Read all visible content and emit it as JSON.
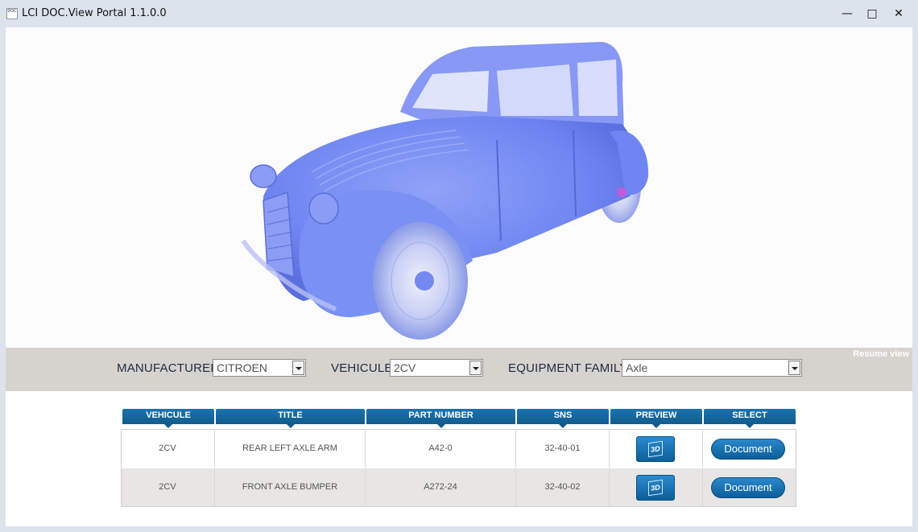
{
  "window": {
    "title": "LCI DOC.View Portal 1.1.0.0",
    "icon_text": "DOC",
    "minimize": "—",
    "maximize": "□",
    "close": "✕"
  },
  "viewer": {
    "model_name": "car-3d-model",
    "model_color": "#6f86f2"
  },
  "filters": {
    "resume_view": "Resume view",
    "manufacturer_label": "MANUFACTURER",
    "manufacturer_value": "CITROEN",
    "vehicule_label": "VEHICULE",
    "vehicule_value": "2CV",
    "equipment_label": "EQUIPMENT FAMILY",
    "equipment_value": "Axle"
  },
  "table": {
    "headers": [
      "VEHICULE",
      "TITLE",
      "PART NUMBER",
      "SNS",
      "PREVIEW",
      "SELECT"
    ],
    "rows": [
      {
        "vehicule": "2CV",
        "title": "REAR LEFT AXLE ARM",
        "part_number": "A42-0",
        "sns": "32-40-01",
        "preview_icon": "3D",
        "select": "Document"
      },
      {
        "vehicule": "2CV",
        "title": "FRONT AXLE BUMPER",
        "part_number": "A272-24",
        "sns": "32-40-02",
        "preview_icon": "3D",
        "select": "Document"
      }
    ]
  },
  "colors": {
    "header_blue": "#1a74ae",
    "accent_button": "#0c5e98",
    "filter_bar": "#d6d3cf"
  }
}
